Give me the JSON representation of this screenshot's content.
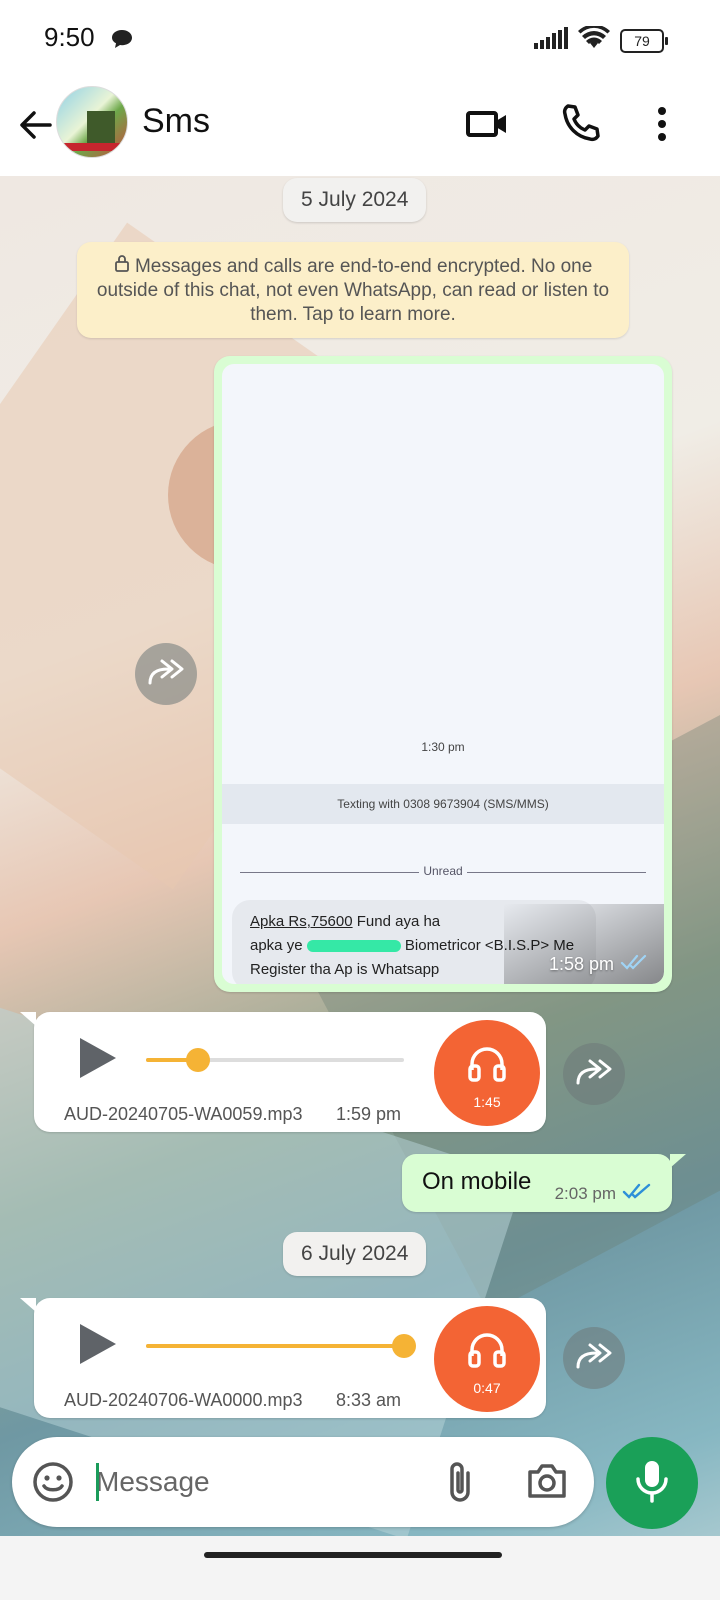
{
  "status_bar": {
    "time": "9:50",
    "battery": "79"
  },
  "header": {
    "title": "Sms"
  },
  "dates": {
    "first": "5 July 2024",
    "second": "6 July 2024"
  },
  "encryption_notice": "Messages and calls are end-to-end encrypted. No one outside of this chat, not even WhatsApp, can read or listen to them. Tap to learn more.",
  "image_message": {
    "screenshot": {
      "time_label": "1:30 pm",
      "texting_label": "Texting with 0308 9673904 (SMS/MMS)",
      "unread_label": "Unread",
      "sms_line1a": "Apka Rs,75600",
      "sms_line1b": " Fund aya ha",
      "sms_line2a": "apka ye ",
      "sms_line2b": " Biometricor <B.I.S.P> Me",
      "sms_line3": "Register tha Ap is Whatsapp"
    },
    "time": "1:58 pm",
    "status": "read"
  },
  "audio_messages": [
    {
      "filename": "AUD-20240705-WA0059.mp3",
      "time": "1:59 pm",
      "duration": "1:45",
      "progress": 0.2
    },
    {
      "filename": "AUD-20240706-WA0000.mp3",
      "time": "8:33 am",
      "duration": "0:47",
      "progress": 1.0
    }
  ],
  "text_message": {
    "text": "On mobile",
    "time": "2:03 pm",
    "status": "read"
  },
  "composer": {
    "placeholder": "Message"
  },
  "colors": {
    "accent_green": "#1aa058",
    "outgoing_bubble": "#d9fdd3",
    "audio_orange": "#f36434",
    "seek_yellow": "#f5b335",
    "read_tick_blue": "#2d8fd8"
  }
}
